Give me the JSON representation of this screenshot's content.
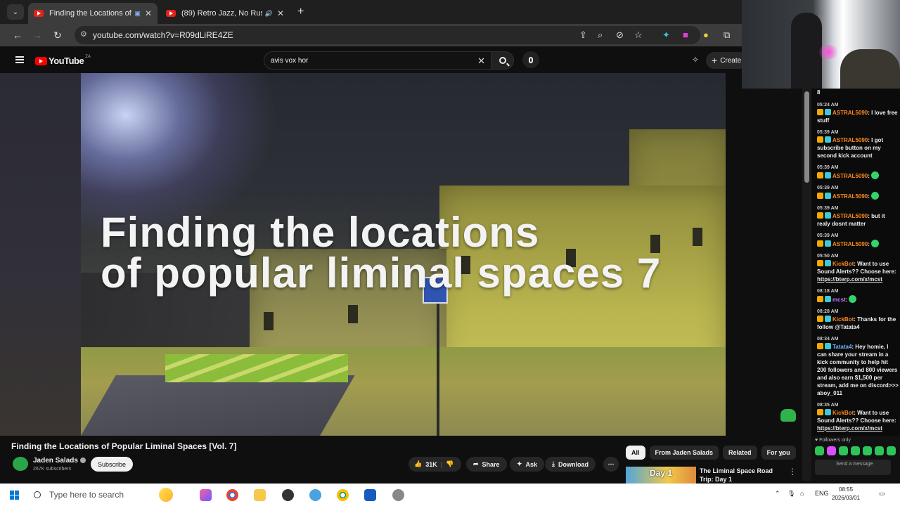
{
  "browser": {
    "tabs": [
      {
        "title": "Finding the Locations of Po",
        "active": true
      },
      {
        "title": "(89) Retro Jazz, No Rush To",
        "active": false
      }
    ],
    "url": "youtube.com/watch?v=R09dLiRE4ZE"
  },
  "youtube": {
    "logo_text": "YouTube",
    "country_code": "ZA",
    "search_value": "avis vox hor",
    "create_label": "Create",
    "video_overlay_title": [
      "Finding the locations",
      "of popular liminal spaces 7"
    ],
    "video_title": "Finding the Locations of Popular Liminal Spaces [Vol. 7]",
    "channel_name": "Jaden Salads",
    "subscribers": "267K subscribers",
    "subscribe_label": "Subscribe",
    "likes": "31K",
    "share_label": "Share",
    "ask_label": "Ask",
    "download_label": "Download",
    "chips": [
      "All",
      "From Jaden Salads",
      "Related",
      "For you"
    ],
    "related": {
      "thumb_text": "Day 1",
      "title": "The Liminal Space Road Trip: Day 1"
    }
  },
  "chat": {
    "top_fragment": "8",
    "messages": [
      {
        "time": "05:24 AM",
        "user": "ASTRAL5090",
        "text": ": I love free stuff"
      },
      {
        "time": "05:39 AM",
        "user": "ASTRAL5090",
        "text": ": I got subscribe button on my second kick account"
      },
      {
        "time": "05:39 AM",
        "user": "ASTRAL5090",
        "text": ":"
      },
      {
        "time": "05:39 AM",
        "user": "ASTRAL5090",
        "text": ":"
      },
      {
        "time": "05:39 AM",
        "user": "ASTRAL5090",
        "text": ": but it realy dosnt matter"
      },
      {
        "time": "05:39 AM",
        "user": "ASTRAL5090",
        "text": ":"
      },
      {
        "time": "05:50 AM",
        "user": "KickBot",
        "text": ": Want to use Sound Alerts?? Choose here:",
        "link": "https://bterp.com/x/mcst"
      },
      {
        "time": "08:18 AM",
        "user": "mcst",
        "text": ":"
      },
      {
        "time": "08:28 AM",
        "user": "KickBot",
        "text": ": Thanks for the follow @Tatata4"
      },
      {
        "time": "08:34 AM",
        "user": "Tatata4",
        "text": ": Hey homie, I can share your stream in a kick community to help hit 200 followers and 800 viewers and also earn $1,500 per stream, add me on discord>>> aboy_011"
      },
      {
        "time": "08:35 AM",
        "user": "KickBot",
        "text": ": Want to use Sound Alerts?? Choose here:",
        "link": "https://bterp.com/x/mcst"
      }
    ],
    "followers_only": "Followers only",
    "send_placeholder": "Send a message"
  },
  "taskbar": {
    "search_placeholder": "Type here to search",
    "language": "ENG",
    "time": "08:55",
    "date": "2026/03/01"
  }
}
